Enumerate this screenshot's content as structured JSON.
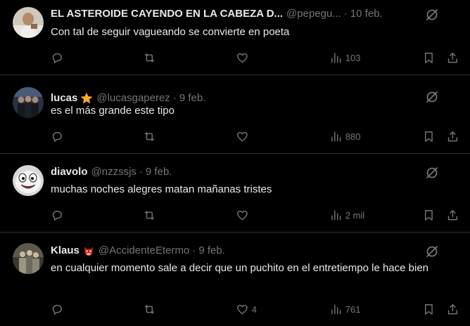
{
  "colors": {
    "background": "#000000",
    "text_primary": "#e7e9ea",
    "text_secondary": "#71767b",
    "divider": "#2f3336"
  },
  "tweets": [
    {
      "name": "EL ASTEROIDE CAYENDO EN LA CABEZA D...",
      "handle": "@pepegu...",
      "date": "10 feb.",
      "text": "Con tal de seguir vagueando se convierte en poeta",
      "replies": "",
      "retweets": "",
      "likes": "",
      "views": "103",
      "more_icon": "grok-slash-icon"
    },
    {
      "name": "lucas",
      "badge_icon": "star-icon",
      "handle": "@lucasgaperez",
      "date": "9 feb.",
      "text": "es el más grande este tipo",
      "replies": "",
      "retweets": "",
      "likes": "",
      "views": "880",
      "more_icon": "grok-slash-icon"
    },
    {
      "name": "diavolo",
      "handle": "@nzzssjs",
      "date": "9 feb.",
      "text": "muchas noches alegres matan mañanas tristes",
      "replies": "",
      "retweets": "",
      "likes": "",
      "views": "2 mil",
      "more_icon": "grok-slash-icon"
    },
    {
      "name": "Klaus",
      "badge_icon": "ogre-mask-icon",
      "handle": "@AccidenteEtermo",
      "date": "9 feb.",
      "text": "en cualquier momento sale a decir que un puchito en el entretiempo le hace bien",
      "replies": "",
      "retweets": "",
      "likes": "4",
      "views": "761",
      "more_icon": "grok-slash-icon"
    }
  ],
  "separator_dot": "·"
}
